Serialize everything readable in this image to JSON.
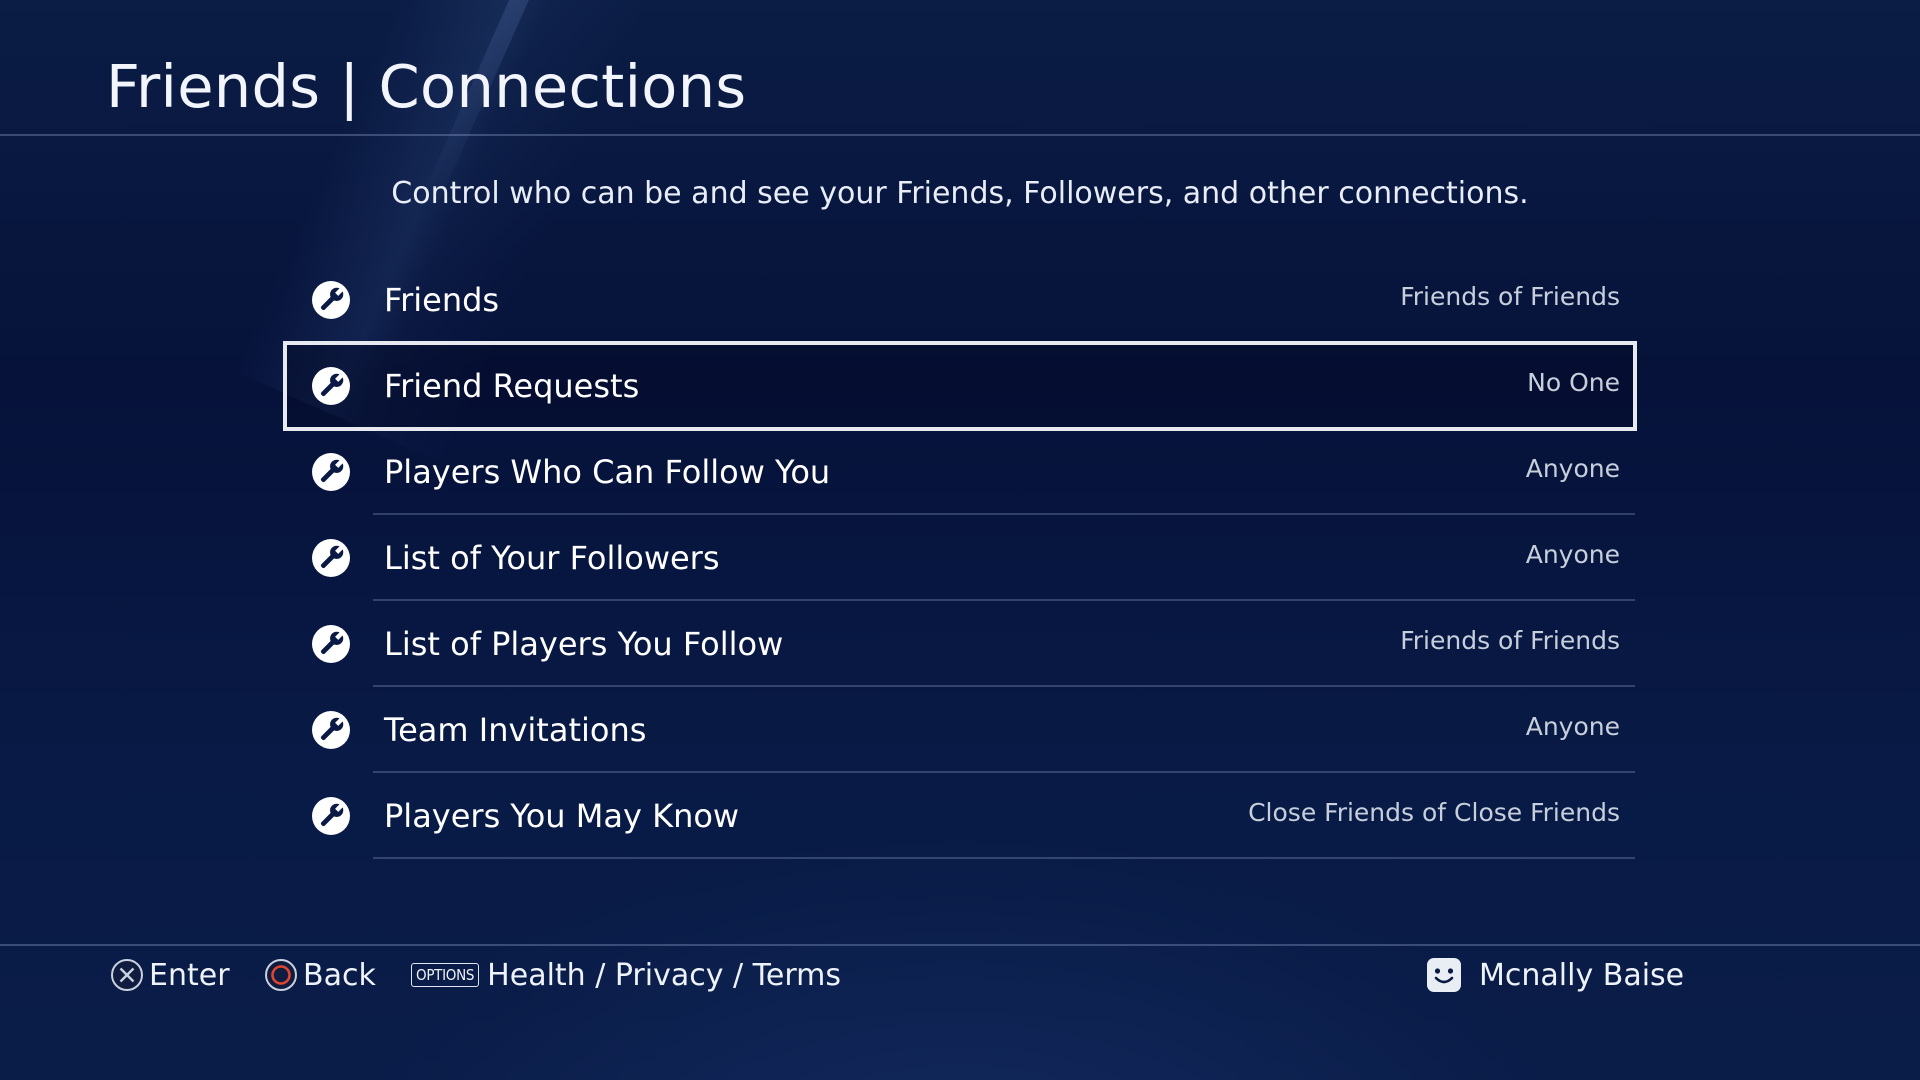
{
  "header": {
    "title": "Friends | Connections",
    "subtitle": "Control who can be and see your Friends, Followers, and other connections."
  },
  "settings": [
    {
      "label": "Friends",
      "value": "Friends of Friends",
      "icon": "wrench-icon",
      "selected": false
    },
    {
      "label": "Friend Requests",
      "value": "No One",
      "icon": "wrench-icon",
      "selected": true
    },
    {
      "label": "Players Who Can Follow You",
      "value": "Anyone",
      "icon": "wrench-icon",
      "selected": false
    },
    {
      "label": "List of Your Followers",
      "value": "Anyone",
      "icon": "wrench-icon",
      "selected": false
    },
    {
      "label": "List of Players You Follow",
      "value": "Friends of Friends",
      "icon": "wrench-icon",
      "selected": false
    },
    {
      "label": "Team Invitations",
      "value": "Anyone",
      "icon": "wrench-icon",
      "selected": false
    },
    {
      "label": "Players You May Know",
      "value": "Close Friends of Close Friends",
      "icon": "wrench-icon",
      "selected": false
    }
  ],
  "footer": {
    "enter_label": "Enter",
    "back_label": "Back",
    "options_badge": "OPTIONS",
    "options_label": "Health / Privacy / Terms",
    "user_name": "Mcnally Baise"
  },
  "colors": {
    "background": "#06123a",
    "selection_border": "#e6e9f0",
    "back_button": "#e0452f"
  }
}
